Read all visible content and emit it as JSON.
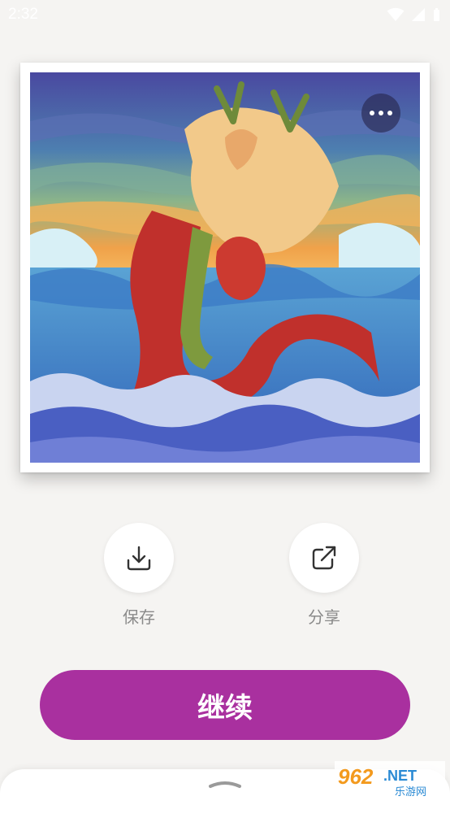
{
  "status_bar": {
    "time": "2:32"
  },
  "artwork": {
    "more_icon": "more-horizontal-icon"
  },
  "actions": {
    "save": {
      "label": "保存",
      "icon": "download-icon"
    },
    "share": {
      "label": "分享",
      "icon": "share-external-icon"
    }
  },
  "continue_button": {
    "label": "继续",
    "color": "#a9309f"
  },
  "watermark": {
    "brand": "962.NET",
    "subtitle": "乐游网"
  },
  "colors": {
    "background": "#f5f4f2",
    "accent": "#a9309f",
    "label_gray": "#8a8a8a"
  }
}
